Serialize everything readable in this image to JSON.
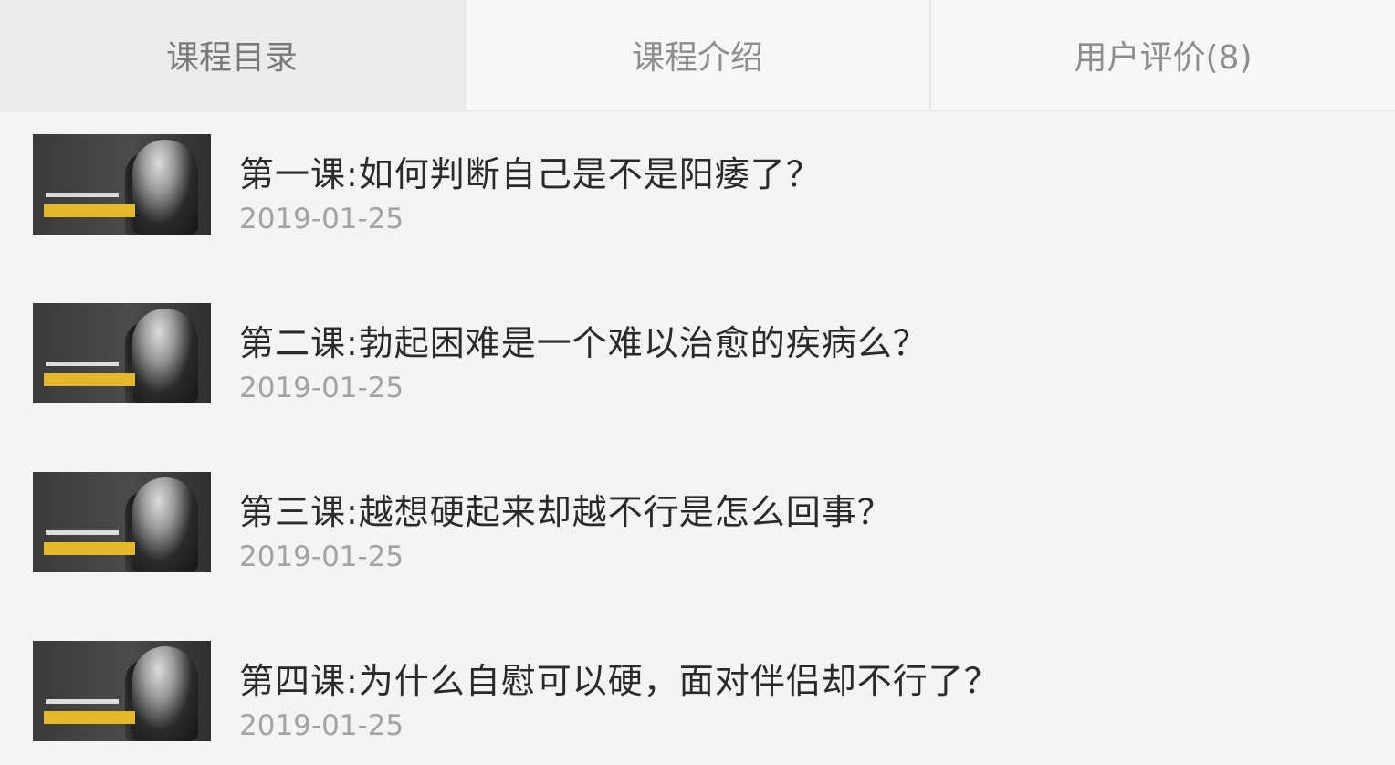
{
  "tabs": [
    {
      "label": "课程目录",
      "active": true
    },
    {
      "label": "课程介绍",
      "active": false
    },
    {
      "label": "用户评价(8)",
      "active": false
    }
  ],
  "lessons": [
    {
      "title": "第一课:如何判断自己是不是阳痿了？",
      "date": "2019-01-25"
    },
    {
      "title": "第二课:勃起困难是一个难以治愈的疾病么？",
      "date": "2019-01-25"
    },
    {
      "title": "第三课:越想硬起来却越不行是怎么回事？",
      "date": "2019-01-25"
    },
    {
      "title": "第四课:为什么自慰可以硬，面对伴侣却不行了？",
      "date": "2019-01-25"
    }
  ],
  "colors": {
    "thumbnail_accent": "#e3b92b"
  }
}
